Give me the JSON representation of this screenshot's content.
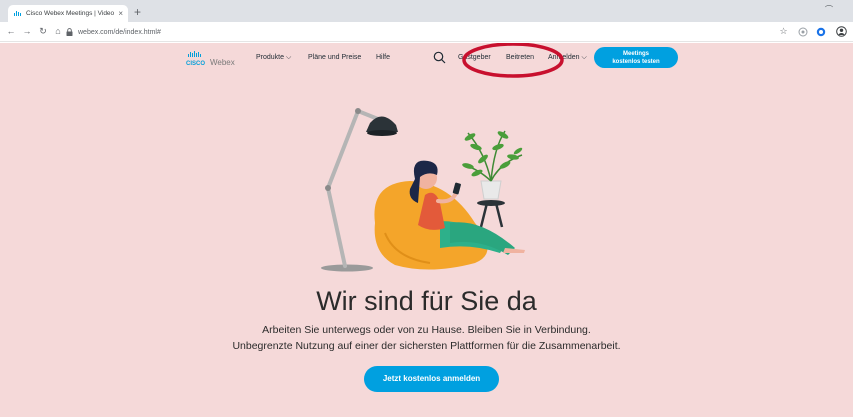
{
  "browser": {
    "tab_title": "Cisco Webex Meetings | Videoc",
    "tab_close": "×",
    "new_tab": "+",
    "minimize": "⌒",
    "url": "webex.com/de/index.html#"
  },
  "site": {
    "logo_text": "cisco Webex",
    "nav": {
      "produkte": "Produkte ⌵",
      "plaene": "Pläne und Preise",
      "hilfe": "Hilfe",
      "gastgeber": "Gastgeber",
      "beitreten": "Beitreten",
      "anmelden": "Anmelden ⌵"
    },
    "cta_top_line1": "Meetings",
    "cta_top_line2": "kostenlos testen"
  },
  "hero": {
    "title": "Wir sind für Sie da",
    "subtitle_line1": "Arbeiten Sie unterwegs oder von zu Hause. Bleiben Sie in Verbindung.",
    "subtitle_line2": "Unbegrenzte Nutzung auf einer der sichersten Plattformen für die Zusammenarbeit.",
    "cta_label": "Jetzt kostenlos anmelden"
  },
  "colors": {
    "page_background": "#f5d9d9",
    "accent_blue": "#00a0e0",
    "annotation_red": "#c8102e"
  },
  "icons": [
    "favicon-icon",
    "back-arrow-icon",
    "forward-arrow-icon",
    "reload-icon",
    "home-icon",
    "lock-icon",
    "star-icon",
    "extension-icon",
    "profile-icon",
    "search-icon"
  ]
}
